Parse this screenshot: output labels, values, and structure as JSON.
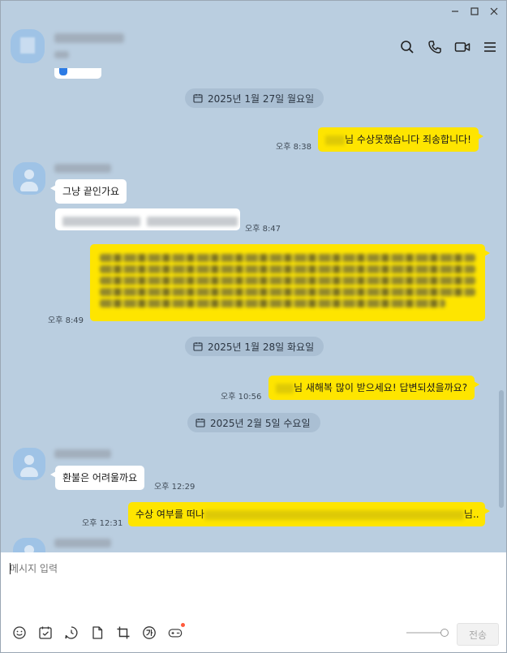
{
  "header": {
    "search_icon": "search-icon",
    "call_icon": "phone-icon",
    "video_icon": "video-icon",
    "menu_icon": "menu-icon"
  },
  "colors": {
    "chat_background": "#bacee0",
    "my_bubble": "#fee500",
    "other_bubble": "#ffffff",
    "date_pill": "#aabfd3"
  },
  "dates": {
    "d1": "2025년 1월 27일 월요일",
    "d2": "2025년 1월 28일 화요일",
    "d3": "2025년 2월 5일 수요일"
  },
  "messages": {
    "m1_text": "님 수상못했습니다 죄송합니다!",
    "m1_time": "오후 8:38",
    "m2_text": "그냥 끝인가요",
    "m3_time": "오후 8:47",
    "m4_time": "오후 8:49",
    "m5_text": "님 새해복 많이 받으세요! 답변되셨을까요?",
    "m5_time": "오후 10:56",
    "m6_text": "환불은 어려울까요",
    "m6_time": "오후 12:29",
    "m7_text_start": "수상 여부를 떠나",
    "m7_text_end": "님..",
    "m7_time": "오후 12:31"
  },
  "input": {
    "placeholder": "메시지 입력",
    "send_label": "전송"
  },
  "toolbar": {
    "icons": [
      "emoji-icon",
      "schedule-icon",
      "clock-icon",
      "file-icon",
      "crop-icon",
      "translate-icon",
      "game-icon"
    ]
  }
}
